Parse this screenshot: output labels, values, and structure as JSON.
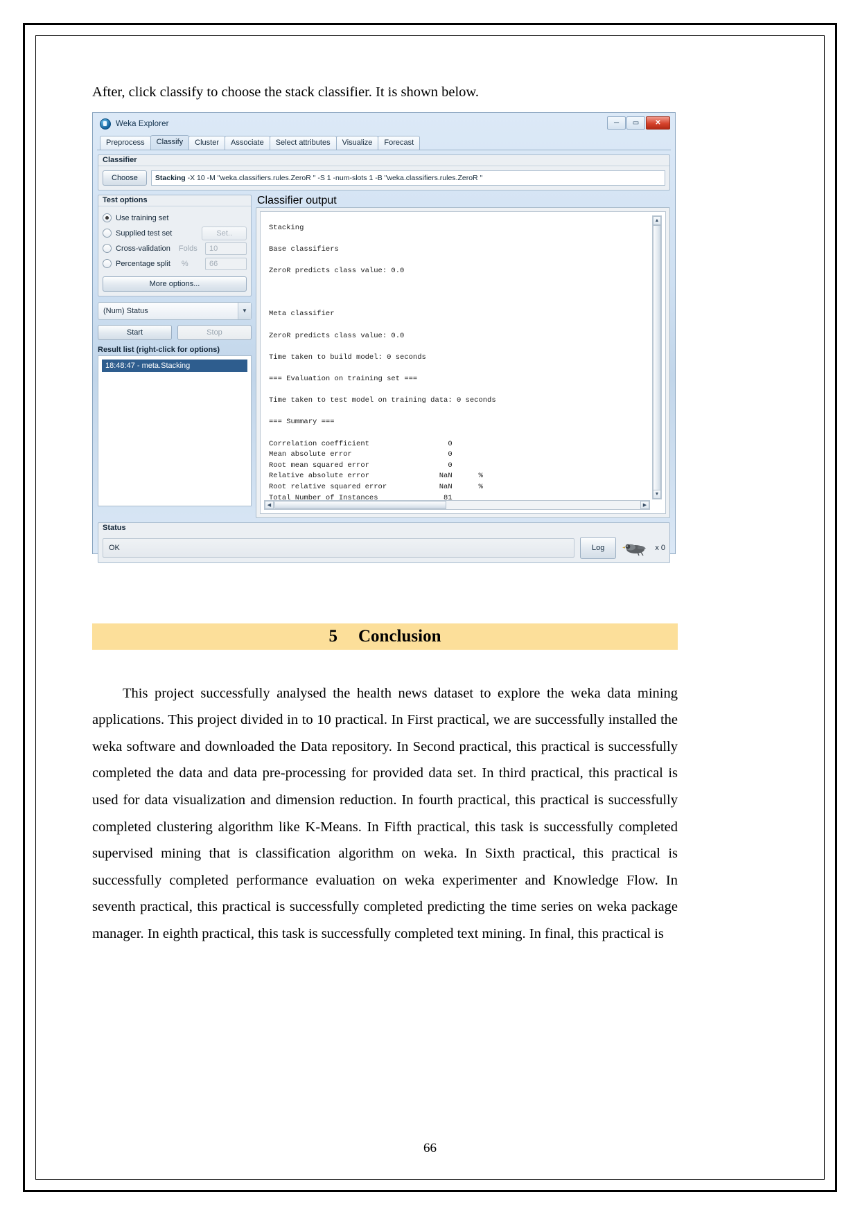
{
  "document": {
    "intro_line": "After, click classify to choose the stack classifier. It is shown below.",
    "page_number": "66"
  },
  "weka": {
    "window_title": "Weka Explorer",
    "window_buttons": {
      "minimize": "─",
      "maximize": "▭",
      "close": "✕"
    },
    "tabs": [
      {
        "label": "Preprocess",
        "active": false
      },
      {
        "label": "Classify",
        "active": true
      },
      {
        "label": "Cluster",
        "active": false
      },
      {
        "label": "Associate",
        "active": false
      },
      {
        "label": "Select attributes",
        "active": false
      },
      {
        "label": "Visualize",
        "active": false
      },
      {
        "label": "Forecast",
        "active": false
      }
    ],
    "classifier_panel": {
      "title": "Classifier",
      "choose_button": "Choose",
      "scheme_name": "Stacking",
      "scheme_options": " -X 10 -M \"weka.classifiers.rules.ZeroR \" -S 1 -num-slots 1 -B \"weka.classifiers.rules.ZeroR \""
    },
    "test_options": {
      "title": "Test options",
      "items": [
        {
          "label": "Use training set",
          "selected": true
        },
        {
          "label": "Supplied test set",
          "selected": false
        },
        {
          "label": "Cross-validation",
          "selected": false
        },
        {
          "label": "Percentage split",
          "selected": false
        }
      ],
      "set_button": "Set..",
      "folds_label": "Folds",
      "folds_value": "10",
      "percent_label": "%",
      "percent_value": "66",
      "more_options_button": "More options..."
    },
    "class_combo": {
      "value": "(Num) Status",
      "arrow_icon": "▼"
    },
    "start_button": "Start",
    "stop_button": "Stop",
    "result_list": {
      "label": "Result list (right-click for options)",
      "items": [
        "18:48:47 - meta.Stacking"
      ]
    },
    "classifier_output": {
      "title": "Classifier output",
      "text": "Stacking\n\nBase classifiers\n\nZeroR predicts class value: 0.0\n\n\n\nMeta classifier\n\nZeroR predicts class value: 0.0\n\nTime taken to build model: 0 seconds\n\n=== Evaluation on training set ===\n\nTime taken to test model on training data: 0 seconds\n\n=== Summary ===\n\nCorrelation coefficient                  0\nMean absolute error                      0\nRoot mean squared error                  0\nRelative absolute error                NaN      %\nRoot relative squared error            NaN      %\nTotal Number of Instances               81"
    },
    "summary_stats": [
      {
        "metric": "Correlation coefficient",
        "value": "0",
        "unit": ""
      },
      {
        "metric": "Mean absolute error",
        "value": "0",
        "unit": ""
      },
      {
        "metric": "Root mean squared error",
        "value": "0",
        "unit": ""
      },
      {
        "metric": "Relative absolute error",
        "value": "NaN",
        "unit": "%"
      },
      {
        "metric": "Root relative squared error",
        "value": "NaN",
        "unit": "%"
      },
      {
        "metric": "Total Number of Instances",
        "value": "81",
        "unit": ""
      }
    ],
    "status_panel": {
      "title": "Status",
      "message": "OK",
      "log_button": "Log",
      "task_count": "x 0"
    }
  },
  "conclusion": {
    "section_number": "5",
    "section_title": "Conclusion",
    "paragraph": "This project successfully analysed the health news dataset to explore the weka data mining applications. This project divided in to 10 practical. In First practical, we are successfully installed the weka software and downloaded the Data repository. In Second practical, this practical is successfully completed the data and data pre-processing for provided data set. In third practical, this practical is used for data visualization and dimension reduction. In fourth practical, this practical is successfully completed clustering algorithm like K-Means. In Fifth practical, this task is successfully completed supervised mining that is classification algorithm on weka. In Sixth practical, this practical is successfully completed performance evaluation on weka experimenter and Knowledge Flow. In seventh practical, this practical is successfully completed predicting the time series on weka package manager. In eighth practical, this task is successfully completed text mining. In final, this practical is"
  },
  "colors": {
    "section_bar": "#fcdf9a",
    "selection": "#2e5d8e",
    "close_button": "#d6432c"
  }
}
